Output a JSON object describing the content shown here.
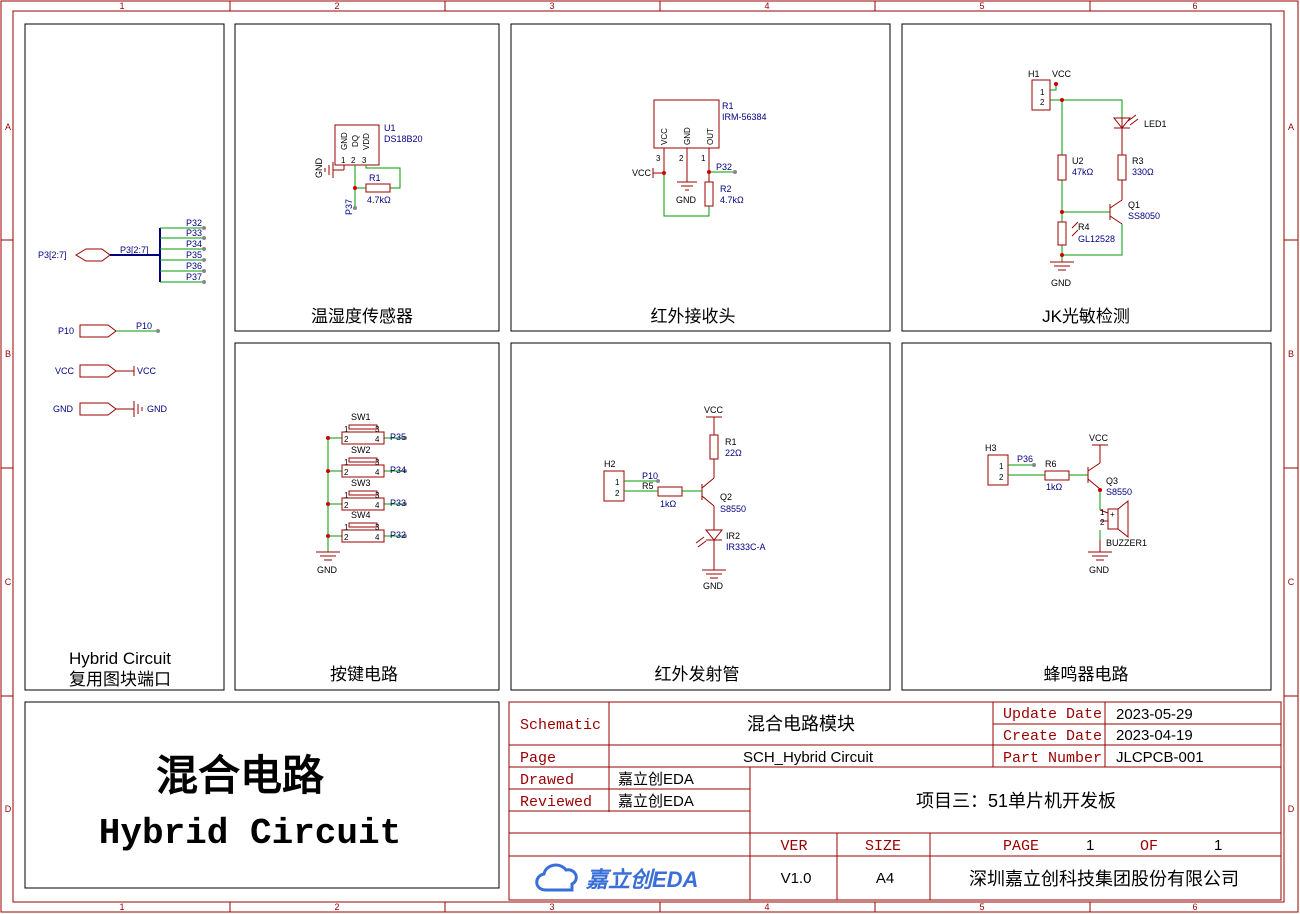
{
  "frame": {
    "col_markers": [
      "1",
      "2",
      "3",
      "4",
      "5",
      "6"
    ],
    "row_markers": [
      "A",
      "B",
      "C",
      "D"
    ]
  },
  "colors": {
    "border": "#990000",
    "wire": "#009900",
    "label": "#000080",
    "part": "#990000",
    "pin": "#cc0000"
  },
  "port_panel": {
    "title_line1": "Hybrid Circuit",
    "title_line2": "复用图块端口",
    "bus_port": "P3[2:7]",
    "bus_label": "P3[2:7]",
    "bus_nets": [
      "P32",
      "P33",
      "P34",
      "P35",
      "P36",
      "P37"
    ],
    "p10_port": "P10",
    "p10_net": "P10",
    "vcc_port": "VCC",
    "vcc_net": "VCC",
    "gnd_port": "GND",
    "gnd_net": "GND"
  },
  "panels": {
    "temp": {
      "title": "温湿度传感器",
      "u1_ref": "U1",
      "u1_val": "DS18B20",
      "pin_gnd": "GND",
      "pin_dq": "DQ",
      "pin_vdd": "VDD",
      "pin1": "1",
      "pin2": "2",
      "pin3": "3",
      "gnd": "GND",
      "r1_ref": "R1",
      "r1_val": "4.7kΩ",
      "net": "P37"
    },
    "ir_rx": {
      "title": "红外接收头",
      "r1_ref": "R1",
      "r1_val": "IRM-56384",
      "pin_vcc": "VCC",
      "pin_gnd": "GND",
      "pin_out": "OUT",
      "pin3": "3",
      "pin2": "2",
      "pin1": "1",
      "vcc": "VCC",
      "gnd": "GND",
      "net": "P32",
      "r2_ref": "R2",
      "r2_val": "4.7kΩ"
    },
    "light": {
      "title": "JK光敏检测",
      "h1": "H1",
      "vcc": "VCC",
      "p1": "1",
      "p2": "2",
      "led": "LED1",
      "u2_ref": "U2",
      "u2_val": "47kΩ",
      "r3_ref": "R3",
      "r3_val": "330Ω",
      "q1_ref": "Q1",
      "q1_val": "SS8050",
      "r4_ref": "R4",
      "r4_val": "GL12528",
      "gnd": "GND"
    },
    "keys": {
      "title": "按键电路",
      "switches": [
        {
          "ref": "SW1",
          "net": "P35"
        },
        {
          "ref": "SW2",
          "net": "P34"
        },
        {
          "ref": "SW3",
          "net": "P33"
        },
        {
          "ref": "SW4",
          "net": "P32"
        }
      ],
      "p1": "1",
      "p2": "2",
      "p3": "3",
      "p4": "4",
      "gnd": "GND"
    },
    "ir_tx": {
      "title": "红外发射管",
      "vcc": "VCC",
      "r1_ref": "R1",
      "r1_val": "22Ω",
      "h2": "H2",
      "p1": "1",
      "p2": "2",
      "net": "P10",
      "r5_ref": "R5",
      "r5_val": "1kΩ",
      "q2_ref": "Q2",
      "q2_val": "S8550",
      "ir2_ref": "IR2",
      "ir2_val": "IR333C-A",
      "gnd": "GND"
    },
    "buzzer": {
      "title": "蜂鸣器电路",
      "vcc": "VCC",
      "h3": "H3",
      "p1": "1",
      "p2": "2",
      "net": "P36",
      "r6_ref": "R6",
      "r6_val": "1kΩ",
      "q3_ref": "Q3",
      "q3_val": "S8550",
      "bz_ref": "BUZZER1",
      "plus": "+",
      "gnd": "GND"
    }
  },
  "title_block": {
    "big_title_cn": "混合电路",
    "big_title_en": "Hybrid Circuit",
    "schematic_label": "Schematic",
    "schematic_value": "混合电路模块",
    "page_label": "Page",
    "page_value": "SCH_Hybrid Circuit",
    "drawed_label": "Drawed",
    "drawed_value": "嘉立创EDA",
    "reviewed_label": "Reviewed",
    "reviewed_value": "嘉立创EDA",
    "update_label": "Update Date",
    "update_value": "2023-05-29",
    "create_label": "Create Date",
    "create_value": "2023-04-19",
    "part_label": "Part Number",
    "part_value": "JLCPCB-001",
    "project": "项目三：51单片机开发板",
    "ver_label": "VER",
    "ver_value": "V1.0",
    "size_label": "SIZE",
    "size_value": "A4",
    "page_no_label": "PAGE",
    "page_no": "1",
    "of_label": "OF",
    "of_no": "1",
    "logo_text": "嘉立创EDA",
    "company": "深圳嘉立创科技集团股份有限公司"
  }
}
